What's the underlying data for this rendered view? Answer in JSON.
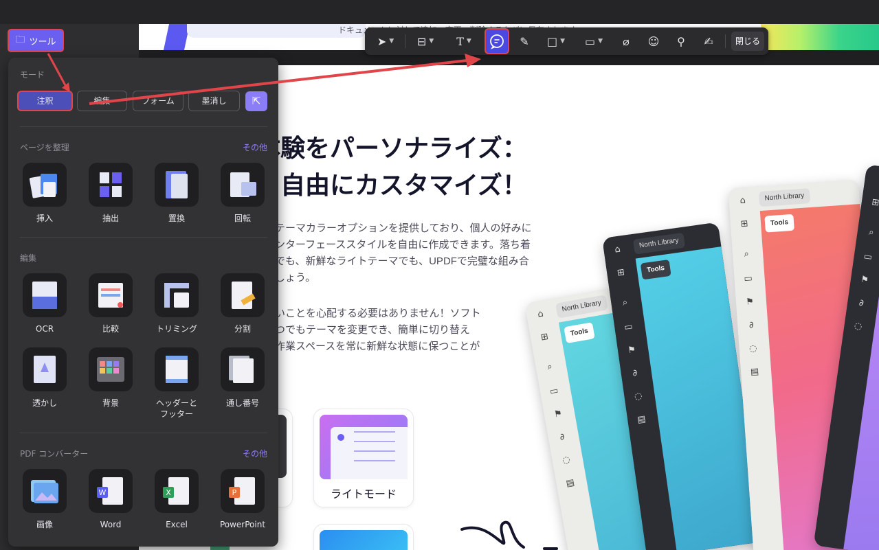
{
  "doc": {
    "notice": "ドキュメントに対して追加・変更・削除するたびに保存されます。",
    "headline1": "体験をパーソナライズ：",
    "headline2": "を自由にカスタマイズ！",
    "para1": [
      "テーマカラーオプションを提供しており、個人の好みに",
      "ンターフェーススタイルを自由に作成できます。落ち着",
      "でも、新鮮なライトテーマでも、UPDFで完璧な組み合",
      "しょう。"
    ],
    "para2": [
      "いことを心配する必要はありません！ソフト",
      "つでもテーマを変更でき、簡単に切り替え",
      "作業スペースを常に新鮮な状態に保つことが"
    ],
    "light_mode_label": "ライトモード",
    "windows": [
      {
        "tab": "North Library",
        "tools": "Tools"
      },
      {
        "tab": "North Library",
        "tools": "Tools"
      },
      {
        "tab": "North Library",
        "tools": "Tools"
      }
    ]
  },
  "toolbar": {
    "close_label": "閉じる",
    "icons": [
      "cursor-icon",
      "text-box-icon",
      "text-icon",
      "comment-icon",
      "pen-icon",
      "shape-icon",
      "measure-icon",
      "attachment-icon",
      "sticker-icon",
      "stamp-icon",
      "signature-icon"
    ]
  },
  "tools_button": {
    "label": "ツール"
  },
  "panel": {
    "mode": {
      "title": "モード",
      "buttons": [
        "注釈",
        "編集",
        "フォーム",
        "墨消し"
      ]
    },
    "organize": {
      "title": "ページを整理",
      "more": "その他",
      "items": [
        "挿入",
        "抽出",
        "置換",
        "回転"
      ]
    },
    "edit": {
      "title": "編集",
      "items": [
        "OCR",
        "比較",
        "トリミング",
        "分割",
        "透かし",
        "背景",
        "ヘッダーと",
        "フッター",
        "通し番号"
      ]
    },
    "converter": {
      "title": "PDF コンバーター",
      "more": "その他",
      "items": [
        "画像",
        "Word",
        "Excel",
        "PowerPoint"
      ]
    }
  },
  "colors": {
    "accent": "#6b5ff0",
    "highlight": "#e0454a",
    "panel": "#323235"
  }
}
